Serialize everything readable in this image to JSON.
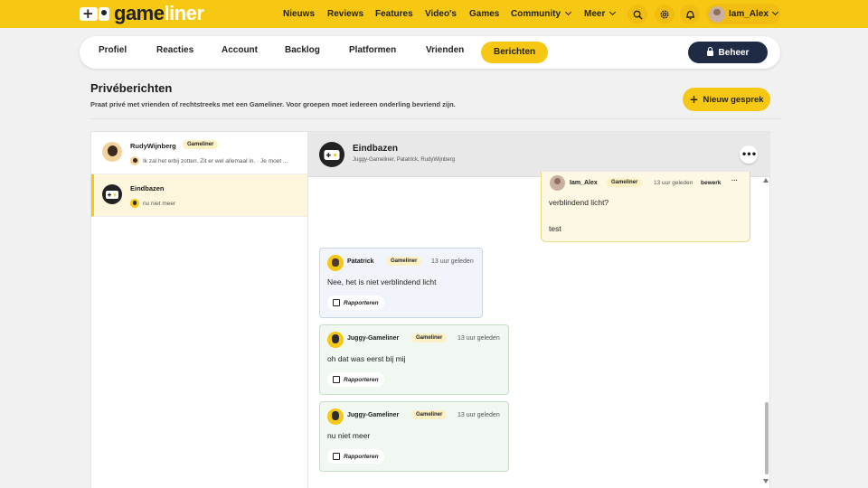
{
  "brand": {
    "logo_text_a": "game",
    "logo_text_b": "liner"
  },
  "mainnav": [
    {
      "label": "Nieuws"
    },
    {
      "label": "Reviews"
    },
    {
      "label": "Features"
    },
    {
      "label": "Video's"
    },
    {
      "label": "Games"
    },
    {
      "label": "Community",
      "dropdown": true
    },
    {
      "label": "Meer",
      "dropdown": true
    }
  ],
  "user": {
    "name": "Iam_Alex"
  },
  "subnav": {
    "tabs": [
      {
        "label": "Profiel"
      },
      {
        "label": "Reacties"
      },
      {
        "label": "Account"
      },
      {
        "label": "Backlog"
      },
      {
        "label": "Platformen"
      },
      {
        "label": "Vrienden"
      },
      {
        "label": "Berichten",
        "active": true
      }
    ],
    "beheer_label": "Beheer"
  },
  "header": {
    "title": "Privéberichten",
    "subtitle": "Praat privé met vrienden of rechtstreeks met een Gameliner. Voor groepen moet iedereen onderling bevriend zijn.",
    "new_button": "Nieuw gesprek"
  },
  "conversations": [
    {
      "name": "RudyWijnberg",
      "badge": "Gameliner",
      "preview": "Ik zal het erbij zotten. Zit er wel allemaal in. · Je moet ..."
    },
    {
      "name": "Eindbazen",
      "preview": "nu niet meer",
      "active": true
    }
  ],
  "chat": {
    "title": "Eindbazen",
    "members": "Juggy-Gameliner, Patatrick, RudyWijnberg",
    "messages": [
      {
        "author": "Iam_Alex",
        "badge": "Gameliner",
        "time": "13 uur geleden",
        "edit": "bewerk",
        "menu": "···",
        "line1": "verblindend licht?",
        "line2": "test"
      },
      {
        "author": "Patatrick",
        "badge": "Gameliner",
        "time": "13 uur geleden",
        "text": "Nee, het is niet verblindend licht",
        "report": "Rapporteren"
      },
      {
        "author": "Juggy-Gameliner",
        "badge": "Gameliner",
        "time": "13 uur geleden",
        "text": "oh dat was eerst bij mij",
        "report": "Rapporteren"
      },
      {
        "author": "Juggy-Gameliner",
        "badge": "Gameliner",
        "time": "13 uur geleden",
        "text": "nu niet meer",
        "report": "Rapporteren"
      }
    ]
  },
  "colors": {
    "accent": "#f6c814",
    "dark": "#1f2a44"
  },
  "icons": {
    "search": "search-icon",
    "settings": "gear-icon",
    "notifications": "bell-icon",
    "more": "more-icon",
    "report": "flag-icon"
  }
}
